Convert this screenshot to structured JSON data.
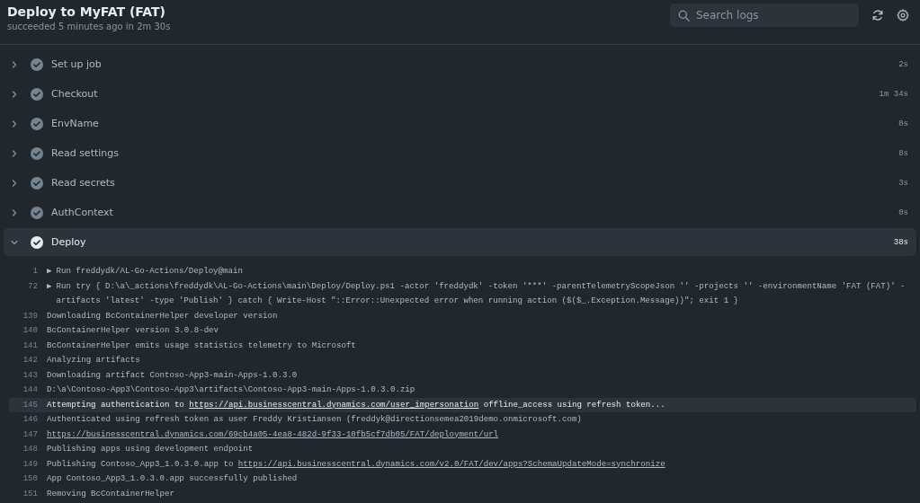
{
  "header": {
    "title": "Deploy to MyFAT (FAT)",
    "subtitle": "succeeded 5 minutes ago in 2m 30s",
    "search": {
      "placeholder": "Search logs"
    }
  },
  "steps": [
    {
      "name": "Set up job",
      "duration": "2s",
      "expanded": false
    },
    {
      "name": "Checkout",
      "duration": "1m 34s",
      "expanded": false
    },
    {
      "name": "EnvName",
      "duration": "0s",
      "expanded": false
    },
    {
      "name": "Read settings",
      "duration": "8s",
      "expanded": false
    },
    {
      "name": "Read secrets",
      "duration": "3s",
      "expanded": false
    },
    {
      "name": "AuthContext",
      "duration": "0s",
      "expanded": false
    },
    {
      "name": "Deploy",
      "duration": "38s",
      "expanded": true
    }
  ],
  "log_lines": [
    {
      "number": "1",
      "toggle": "▶",
      "highlighted": false,
      "parts": [
        {
          "kind": "text",
          "text": "Run freddydk/AL-Go-Actions/Deploy@main"
        }
      ]
    },
    {
      "number": "72",
      "toggle": "▶",
      "highlighted": false,
      "parts": [
        {
          "kind": "text",
          "text": "Run try { D:\\a\\_actions\\freddydk\\AL-Go-Actions\\main\\Deploy/Deploy.ps1 -actor 'freddydk' -token '***' -parentTelemetryScopeJson '' -projects '' -environmentName 'FAT (FAT)' -artifacts 'latest' -type 'Publish' } catch { Write-Host \"::Error::Unexpected error when running action ($($_.Exception.Message))\"; exit 1 }"
        }
      ]
    },
    {
      "number": "139",
      "highlighted": false,
      "parts": [
        {
          "kind": "text",
          "text": "Downloading BcContainerHelper developer version"
        }
      ]
    },
    {
      "number": "140",
      "highlighted": false,
      "parts": [
        {
          "kind": "text",
          "text": "BcContainerHelper version 3.0.8-dev"
        }
      ]
    },
    {
      "number": "141",
      "highlighted": false,
      "parts": [
        {
          "kind": "text",
          "text": "BcContainerHelper emits usage statistics telemetry to Microsoft"
        }
      ]
    },
    {
      "number": "142",
      "highlighted": false,
      "parts": [
        {
          "kind": "text",
          "text": "Analyzing artifacts"
        }
      ]
    },
    {
      "number": "143",
      "highlighted": false,
      "parts": [
        {
          "kind": "text",
          "text": "Downloading artifact Contoso-App3-main-Apps-1.0.3.0"
        }
      ]
    },
    {
      "number": "144",
      "highlighted": false,
      "parts": [
        {
          "kind": "text",
          "text": "D:\\a\\Contoso-App3\\Contoso-App3\\artifacts\\Contoso-App3-main-Apps-1.0.3.0.zip"
        }
      ]
    },
    {
      "number": "145",
      "highlighted": true,
      "parts": [
        {
          "kind": "text",
          "text": "Attempting authentication to "
        },
        {
          "kind": "link",
          "text": "https://api.businesscentral.dynamics.com/user_impersonation"
        },
        {
          "kind": "text",
          "text": " offline_access using refresh token..."
        }
      ]
    },
    {
      "number": "146",
      "highlighted": false,
      "parts": [
        {
          "kind": "text",
          "text": "Authenticated using refresh token as user Freddy Kristiansen (freddyk@directionsemea2019demo.onmicrosoft.com)"
        }
      ]
    },
    {
      "number": "147",
      "highlighted": false,
      "parts": [
        {
          "kind": "link",
          "text": "https://businesscentral.dynamics.com/69cb4a05-4ea8-482d-9f33-10fb5cf7db05/FAT/deployment/url"
        }
      ]
    },
    {
      "number": "148",
      "highlighted": false,
      "parts": [
        {
          "kind": "text",
          "text": "Publishing apps using development endpoint"
        }
      ]
    },
    {
      "number": "149",
      "highlighted": false,
      "parts": [
        {
          "kind": "text",
          "text": "Publishing Contoso_App3_1.0.3.0.app to "
        },
        {
          "kind": "link",
          "text": "https://api.businesscentral.dynamics.com/v2.0/FAT/dev/apps?SchemaUpdateMode=synchronize"
        }
      ]
    },
    {
      "number": "150",
      "highlighted": false,
      "parts": [
        {
          "kind": "text",
          "text": "App Contoso_App3_1.0.3.0.app successfully published"
        }
      ]
    },
    {
      "number": "151",
      "highlighted": false,
      "parts": [
        {
          "kind": "text",
          "text": "Removing BcContainerHelper"
        }
      ]
    }
  ]
}
